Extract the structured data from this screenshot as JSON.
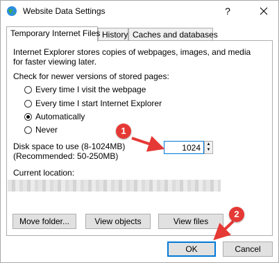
{
  "window": {
    "title": "Website Data Settings",
    "help_glyph": "?"
  },
  "tabs": [
    {
      "label": "Temporary Internet Files",
      "active": true
    },
    {
      "label": "History",
      "active": false
    },
    {
      "label": "Caches and databases",
      "active": false
    }
  ],
  "panel": {
    "description_line1": "Internet Explorer stores copies of webpages, images, and media",
    "description_line2": "for faster viewing later.",
    "check_heading": "Check for newer versions of stored pages:",
    "options": [
      {
        "label": "Every time I visit the webpage",
        "checked": false
      },
      {
        "label": "Every time I start Internet Explorer",
        "checked": false
      },
      {
        "label": "Automatically",
        "checked": true
      },
      {
        "label": "Never",
        "checked": false
      }
    ],
    "disk_label_line1": "Disk space to use (8-1024MB)",
    "disk_label_line2": "(Recommended: 50-250MB)",
    "disk_value": "1024",
    "current_location_label": "Current location:",
    "buttons": {
      "move_folder": "Move folder...",
      "view_objects": "View objects",
      "view_files": "View files"
    }
  },
  "footer": {
    "ok": "OK",
    "cancel": "Cancel"
  },
  "annotations": {
    "badge1": "1",
    "badge2": "2",
    "color": "#e53935"
  }
}
